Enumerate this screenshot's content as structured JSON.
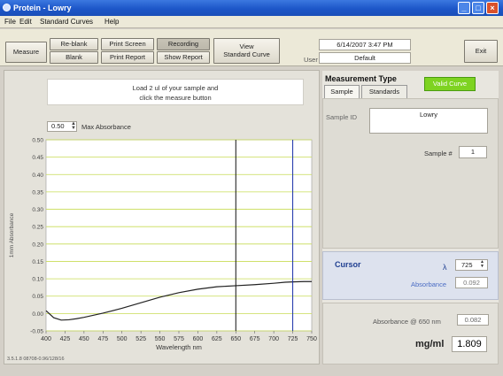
{
  "window": {
    "title": "Protein - Lowry",
    "minimize_icon": "_",
    "maximize_icon": "□",
    "close_icon": "×"
  },
  "menu": [
    "File",
    "Edit",
    "Standard Curves",
    "Help"
  ],
  "toolbar": {
    "measure": "Measure",
    "reblank": "Re-blank",
    "blank": "Blank",
    "print_screen": "Print Screen",
    "print_report": "Print Report",
    "recording": "Recording",
    "show_report": "Show Report",
    "view_standard_curve_1": "View",
    "view_standard_curve_2": "Standard Curve",
    "datetime": "6/14/2007 3:47 PM",
    "user_label": "User",
    "user_value": "Default",
    "exit": "Exit"
  },
  "message": {
    "line1": "Load 2 ul of your sample and",
    "line2": "click the measure button"
  },
  "max_absorbance": {
    "value": "0.50",
    "label": "Max Absorbance"
  },
  "measurement": {
    "title": "Measurement Type",
    "tabs": [
      "Sample",
      "Standards"
    ],
    "valid_curve": "Valid Curve",
    "sample_id_label": "Sample ID",
    "sample_id_value": "Lowry",
    "sample_num_label": "Sample #",
    "sample_num_value": "1"
  },
  "cursor": {
    "title": "Cursor",
    "lambda_label": "λ",
    "lambda_value": "725",
    "absorbance_label": "Absorbance",
    "absorbance_value": "0.092"
  },
  "result": {
    "abs_label": "Absorbance @ 650 nm",
    "abs_value": "0.082",
    "unit": "mg/ml",
    "value": "1.809"
  },
  "footer": "3.5.1.8 08708-0.96/128/16",
  "chart_data": {
    "type": "line",
    "xlabel": "Wavelength nm",
    "ylabel": "1mm Absorbance",
    "xlim": [
      400,
      750
    ],
    "ylim": [
      -0.05,
      0.5
    ],
    "xticks": [
      400,
      425,
      450,
      475,
      500,
      525,
      550,
      575,
      600,
      625,
      650,
      675,
      700,
      725,
      750
    ],
    "yticks": [
      -0.05,
      0.0,
      0.05,
      0.1,
      0.15,
      0.2,
      0.25,
      0.3,
      0.35,
      0.4,
      0.45,
      0.5
    ],
    "ytick_labels": [
      "-0.05",
      "0.00",
      "0.05",
      "0.10",
      "0.15",
      "0.20",
      "0.25",
      "0.30",
      "0.35",
      "0.40",
      "0.45",
      "0.50"
    ],
    "grid": true,
    "series": [
      {
        "color": "#222222",
        "x": [
          400,
          410,
          420,
          430,
          440,
          450,
          475,
          500,
          525,
          550,
          575,
          600,
          625,
          650,
          675,
          700,
          715,
          725,
          740,
          750
        ],
        "y": [
          0.008,
          -0.012,
          -0.019,
          -0.018,
          -0.015,
          -0.011,
          0.001,
          0.015,
          0.031,
          0.047,
          0.06,
          0.07,
          0.077,
          0.08,
          0.083,
          0.087,
          0.09,
          0.091,
          0.092,
          0.092
        ]
      }
    ],
    "vlines": [
      {
        "x": 650,
        "color": "#111111"
      },
      {
        "x": 725,
        "color": "#1a2fa8"
      }
    ],
    "grid_color": "#c8dc55",
    "plot_bg": "#ffffff"
  },
  "colors": {
    "titlebar": "#1d56c8",
    "valid_curve": "#7ed321",
    "cursor_title": "#1f3f91"
  }
}
